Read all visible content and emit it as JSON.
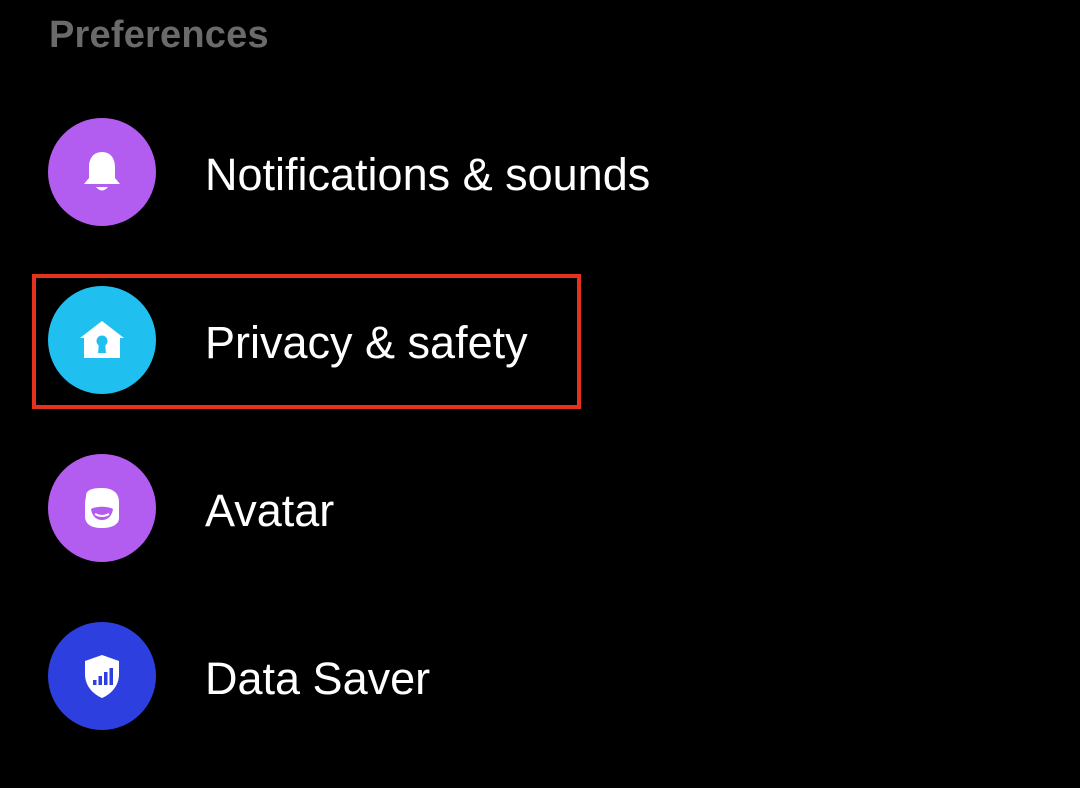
{
  "section": {
    "header": "Preferences"
  },
  "items": [
    {
      "label": "Notifications & sounds",
      "icon": "bell-icon",
      "color": "#b35cf0"
    },
    {
      "label": "Privacy & safety",
      "icon": "house-lock-icon",
      "color": "#1fc0ef"
    },
    {
      "label": "Avatar",
      "icon": "avatar-face-icon",
      "color": "#b35cf0"
    },
    {
      "label": "Data Saver",
      "icon": "shield-signal-icon",
      "color": "#2e3fe0"
    }
  ],
  "highlight": {
    "color": "#e5321f",
    "target": "Privacy & safety"
  }
}
